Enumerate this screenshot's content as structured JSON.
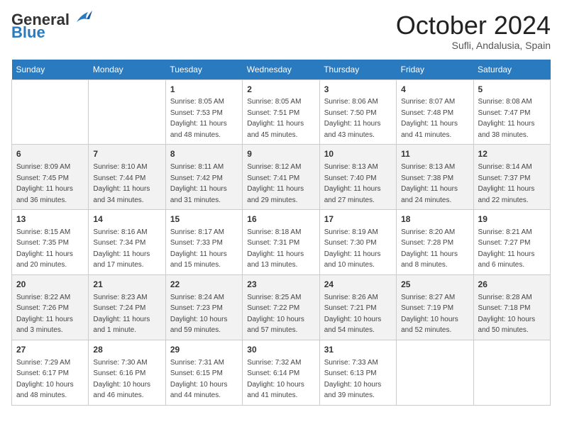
{
  "header": {
    "logo_text_general": "General",
    "logo_text_blue": "Blue",
    "month_title": "October 2024",
    "location": "Sufli, Andalusia, Spain"
  },
  "days_of_week": [
    "Sunday",
    "Monday",
    "Tuesday",
    "Wednesday",
    "Thursday",
    "Friday",
    "Saturday"
  ],
  "weeks": [
    [
      {
        "day": "",
        "empty": true
      },
      {
        "day": "",
        "empty": true
      },
      {
        "day": "1",
        "sunrise": "8:05 AM",
        "sunset": "7:53 PM",
        "daylight": "11 hours and 48 minutes."
      },
      {
        "day": "2",
        "sunrise": "8:05 AM",
        "sunset": "7:51 PM",
        "daylight": "11 hours and 45 minutes."
      },
      {
        "day": "3",
        "sunrise": "8:06 AM",
        "sunset": "7:50 PM",
        "daylight": "11 hours and 43 minutes."
      },
      {
        "day": "4",
        "sunrise": "8:07 AM",
        "sunset": "7:48 PM",
        "daylight": "11 hours and 41 minutes."
      },
      {
        "day": "5",
        "sunrise": "8:08 AM",
        "sunset": "7:47 PM",
        "daylight": "11 hours and 38 minutes."
      }
    ],
    [
      {
        "day": "6",
        "sunrise": "8:09 AM",
        "sunset": "7:45 PM",
        "daylight": "11 hours and 36 minutes."
      },
      {
        "day": "7",
        "sunrise": "8:10 AM",
        "sunset": "7:44 PM",
        "daylight": "11 hours and 34 minutes."
      },
      {
        "day": "8",
        "sunrise": "8:11 AM",
        "sunset": "7:42 PM",
        "daylight": "11 hours and 31 minutes."
      },
      {
        "day": "9",
        "sunrise": "8:12 AM",
        "sunset": "7:41 PM",
        "daylight": "11 hours and 29 minutes."
      },
      {
        "day": "10",
        "sunrise": "8:13 AM",
        "sunset": "7:40 PM",
        "daylight": "11 hours and 27 minutes."
      },
      {
        "day": "11",
        "sunrise": "8:13 AM",
        "sunset": "7:38 PM",
        "daylight": "11 hours and 24 minutes."
      },
      {
        "day": "12",
        "sunrise": "8:14 AM",
        "sunset": "7:37 PM",
        "daylight": "11 hours and 22 minutes."
      }
    ],
    [
      {
        "day": "13",
        "sunrise": "8:15 AM",
        "sunset": "7:35 PM",
        "daylight": "11 hours and 20 minutes."
      },
      {
        "day": "14",
        "sunrise": "8:16 AM",
        "sunset": "7:34 PM",
        "daylight": "11 hours and 17 minutes."
      },
      {
        "day": "15",
        "sunrise": "8:17 AM",
        "sunset": "7:33 PM",
        "daylight": "11 hours and 15 minutes."
      },
      {
        "day": "16",
        "sunrise": "8:18 AM",
        "sunset": "7:31 PM",
        "daylight": "11 hours and 13 minutes."
      },
      {
        "day": "17",
        "sunrise": "8:19 AM",
        "sunset": "7:30 PM",
        "daylight": "11 hours and 10 minutes."
      },
      {
        "day": "18",
        "sunrise": "8:20 AM",
        "sunset": "7:28 PM",
        "daylight": "11 hours and 8 minutes."
      },
      {
        "day": "19",
        "sunrise": "8:21 AM",
        "sunset": "7:27 PM",
        "daylight": "11 hours and 6 minutes."
      }
    ],
    [
      {
        "day": "20",
        "sunrise": "8:22 AM",
        "sunset": "7:26 PM",
        "daylight": "11 hours and 3 minutes."
      },
      {
        "day": "21",
        "sunrise": "8:23 AM",
        "sunset": "7:24 PM",
        "daylight": "11 hours and 1 minute."
      },
      {
        "day": "22",
        "sunrise": "8:24 AM",
        "sunset": "7:23 PM",
        "daylight": "10 hours and 59 minutes."
      },
      {
        "day": "23",
        "sunrise": "8:25 AM",
        "sunset": "7:22 PM",
        "daylight": "10 hours and 57 minutes."
      },
      {
        "day": "24",
        "sunrise": "8:26 AM",
        "sunset": "7:21 PM",
        "daylight": "10 hours and 54 minutes."
      },
      {
        "day": "25",
        "sunrise": "8:27 AM",
        "sunset": "7:19 PM",
        "daylight": "10 hours and 52 minutes."
      },
      {
        "day": "26",
        "sunrise": "8:28 AM",
        "sunset": "7:18 PM",
        "daylight": "10 hours and 50 minutes."
      }
    ],
    [
      {
        "day": "27",
        "sunrise": "7:29 AM",
        "sunset": "6:17 PM",
        "daylight": "10 hours and 48 minutes."
      },
      {
        "day": "28",
        "sunrise": "7:30 AM",
        "sunset": "6:16 PM",
        "daylight": "10 hours and 46 minutes."
      },
      {
        "day": "29",
        "sunrise": "7:31 AM",
        "sunset": "6:15 PM",
        "daylight": "10 hours and 44 minutes."
      },
      {
        "day": "30",
        "sunrise": "7:32 AM",
        "sunset": "6:14 PM",
        "daylight": "10 hours and 41 minutes."
      },
      {
        "day": "31",
        "sunrise": "7:33 AM",
        "sunset": "6:13 PM",
        "daylight": "10 hours and 39 minutes."
      },
      {
        "day": "",
        "empty": true
      },
      {
        "day": "",
        "empty": true
      }
    ]
  ],
  "labels": {
    "sunrise": "Sunrise:",
    "sunset": "Sunset:",
    "daylight": "Daylight:"
  }
}
